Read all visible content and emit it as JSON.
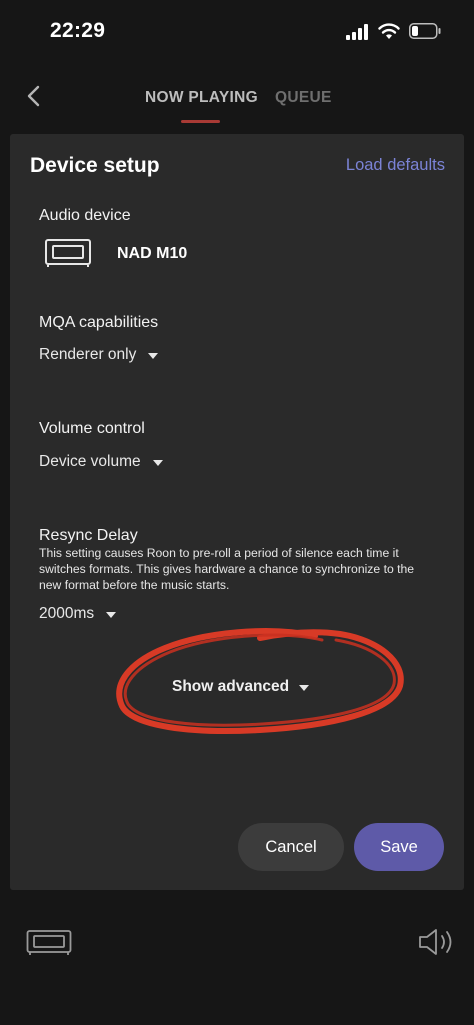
{
  "status_bar": {
    "time": "22:29"
  },
  "nav": {
    "tabs": [
      "NOW PLAYING",
      "QUEUE"
    ],
    "active_tab": "NOW PLAYING"
  },
  "dialog": {
    "title": "Device setup",
    "load_defaults": "Load defaults",
    "audio_device": {
      "label": "Audio device",
      "name": "NAD M10"
    },
    "mqa": {
      "label": "MQA capabilities",
      "value": "Renderer only"
    },
    "volume": {
      "label": "Volume control",
      "value": "Device volume"
    },
    "resync": {
      "label": "Resync Delay",
      "description": "This setting causes Roon to pre-roll a period of silence each time it switches formats. This gives hardware a chance to synchronize to the new format before the music starts.",
      "value": "2000ms"
    },
    "show_advanced": "Show advanced",
    "cancel": "Cancel",
    "save": "Save"
  },
  "colors": {
    "accent": "#7b83d6",
    "save_button": "#5e5aa8",
    "tab_underline": "#a83a35",
    "annotation": "#d83a26"
  }
}
